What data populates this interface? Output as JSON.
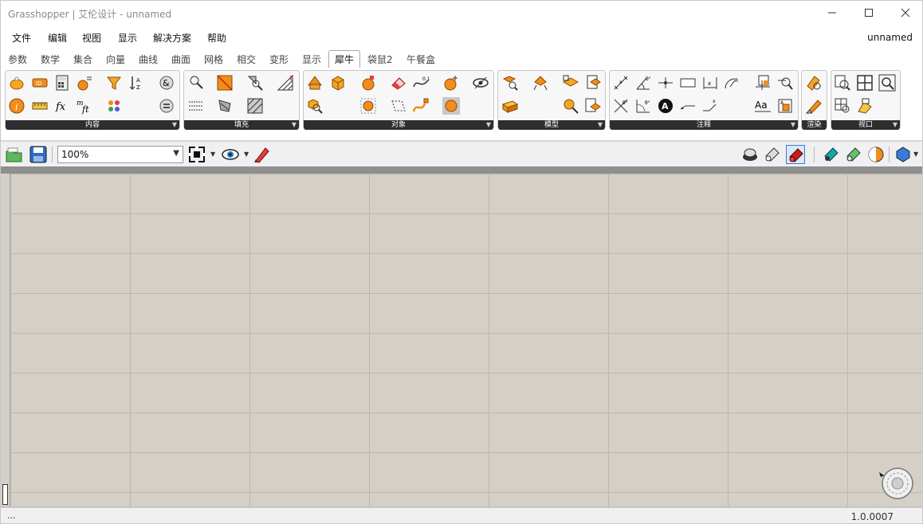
{
  "window": {
    "title": "Grasshopper | 艾伦设计 - unnamed",
    "document_name": "unnamed",
    "controls": [
      "minimize-icon",
      "maximize-icon",
      "close-icon"
    ]
  },
  "menu": [
    {
      "label": "文件"
    },
    {
      "label": "编辑"
    },
    {
      "label": "视图"
    },
    {
      "label": "显示"
    },
    {
      "label": "解决方案"
    },
    {
      "label": "帮助"
    }
  ],
  "tabs": [
    {
      "label": "参数"
    },
    {
      "label": "数学"
    },
    {
      "label": "集合"
    },
    {
      "label": "向量"
    },
    {
      "label": "曲线"
    },
    {
      "label": "曲面"
    },
    {
      "label": "网格"
    },
    {
      "label": "相交"
    },
    {
      "label": "变形"
    },
    {
      "label": "显示"
    },
    {
      "label": "犀牛",
      "active": true
    },
    {
      "label": "袋鼠2"
    },
    {
      "label": "午餐盒"
    }
  ],
  "ribbon": {
    "panels": [
      {
        "label": "内容"
      },
      {
        "label": "填充"
      },
      {
        "label": "对象"
      },
      {
        "label": "模型"
      },
      {
        "label": "注释"
      },
      {
        "label": "渲染"
      },
      {
        "label": "视口"
      }
    ]
  },
  "canvas_toolbar": {
    "zoom": "100%",
    "icons": [
      "open-file-icon",
      "save-file-icon",
      "zoom-extents-icon",
      "preview-eye-icon",
      "sketch-pen-icon",
      "wire-display-icon",
      "shaded-display-icon",
      "selected-display-icon",
      "render-preview-icons",
      "material-sphere-icon"
    ]
  },
  "status": {
    "left": "...",
    "version": "1.0.0007"
  },
  "colors": {
    "canvas_bg": "#d4d0c8",
    "grid_line": "#bcb8b0",
    "panel_bar": "#2e2e2e",
    "accent_orange": "#f28c1a"
  }
}
